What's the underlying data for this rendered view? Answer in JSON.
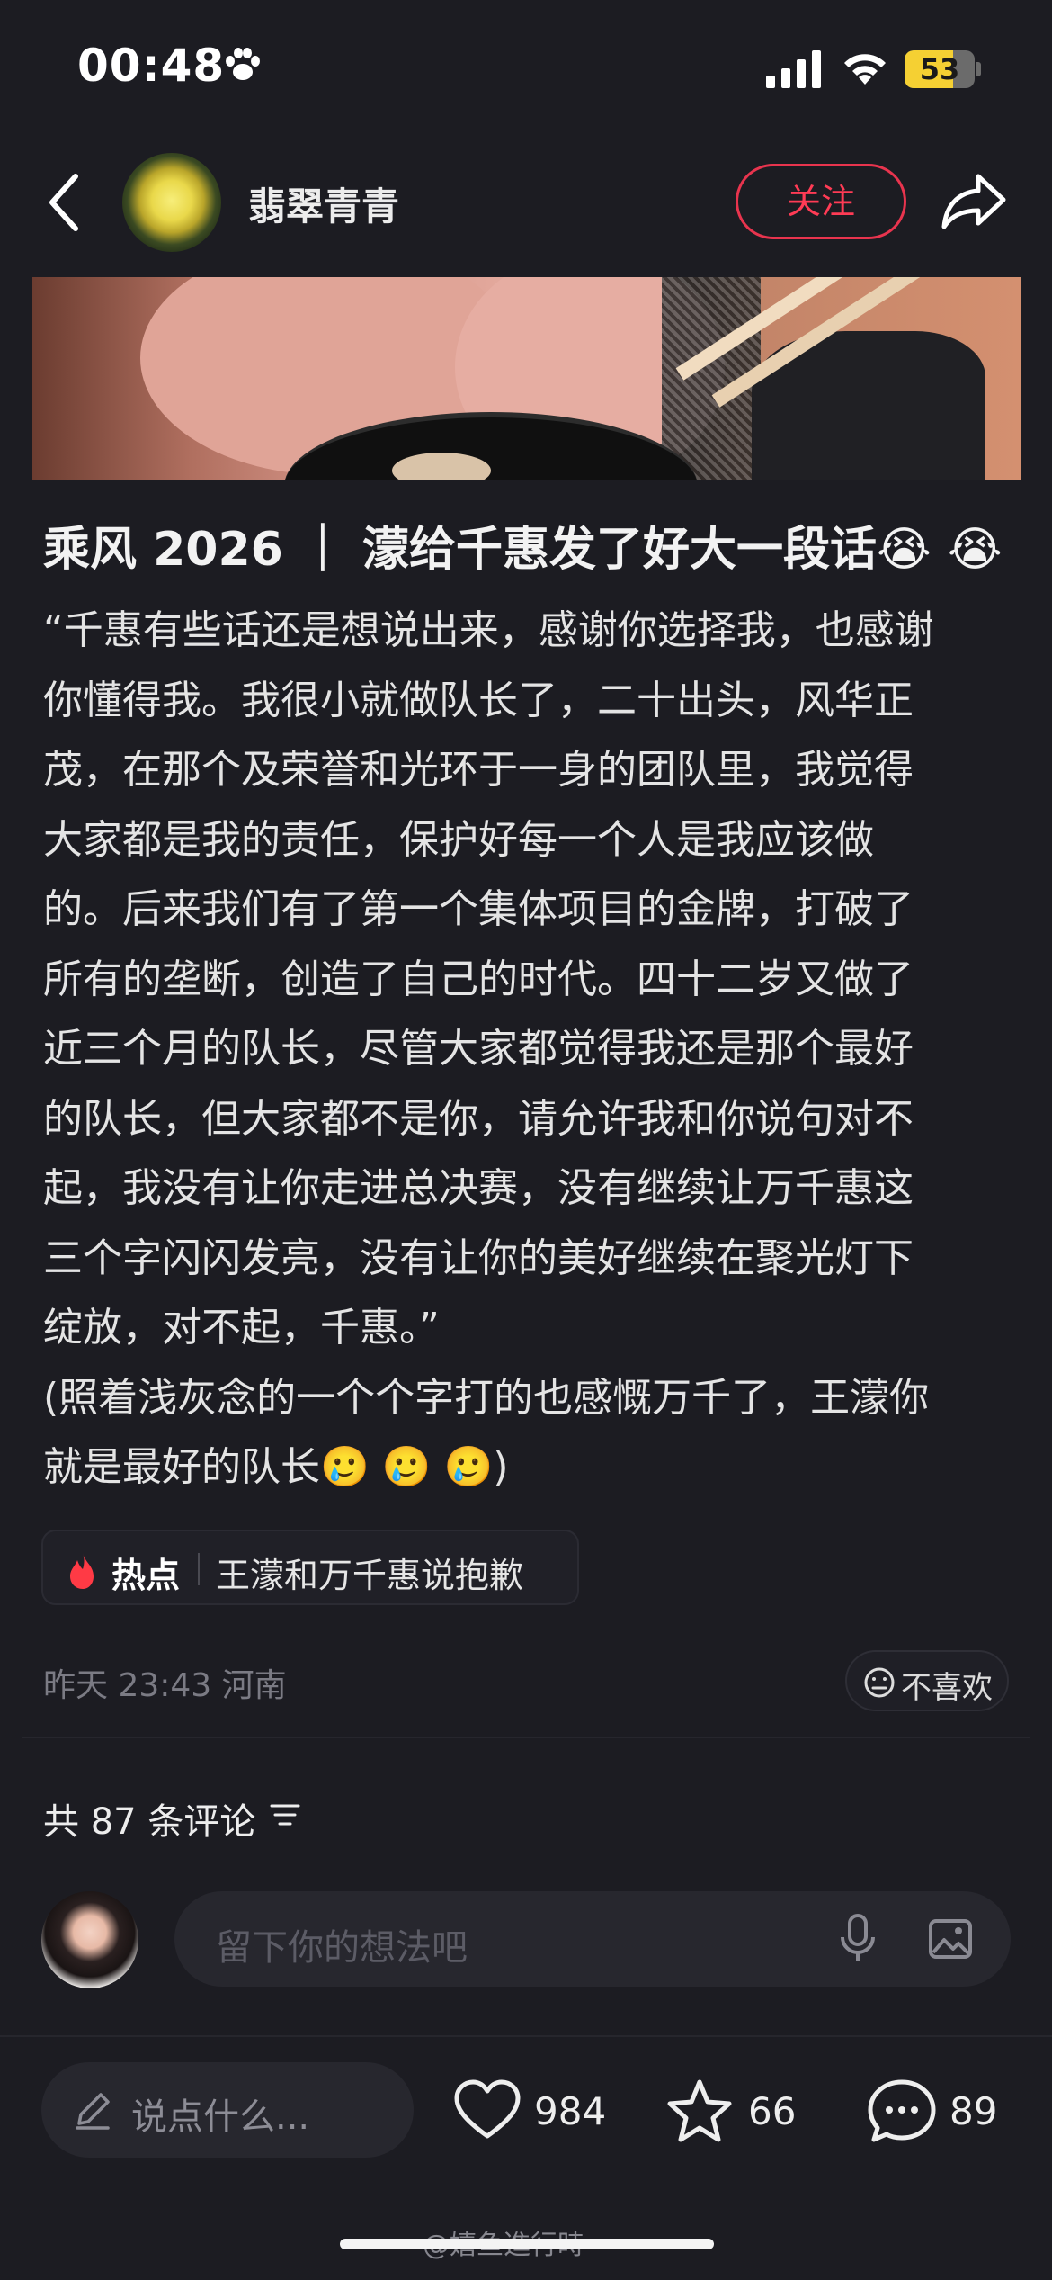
{
  "status_bar": {
    "time": "00:48",
    "battery": "53"
  },
  "header": {
    "author": "翡翠青青",
    "follow_label": "关注"
  },
  "post": {
    "title": "乘风 2026 ｜ 濛给千惠发了好大一段话😭 😭",
    "body": "“千惠有些话还是想说出来，感谢你选择我，也感谢\n你懂得我。我很小就做队长了，二十出头，风华正\n茂，在那个及荣誉和光环于一身的团队里，我觉得\n大家都是我的责任，保护好每一个人是我应该做\n的。后来我们有了第一个集体项目的金牌，打破了\n所有的垄断，创造了自己的时代。四十二岁又做了\n近三个月的队长，尽管大家都觉得我还是那个最好\n的队长，但大家都不是你，请允许我和你说句对不\n起，我没有让你走进总决赛，没有继续让万千惠这\n三个字闪闪发亮，没有让你的美好继续在聚光灯下\n绽放，对不起，千惠。”\n(照着浅灰念的一个个字打的也感慨万千了，王濛你\n就是最好的队长🥲 🥲 🥲)",
    "hot_label": "热点",
    "hot_topic": "王濛和万千惠说抱歉",
    "meta": "昨天 23:43 河南",
    "dislike_label": "不喜欢"
  },
  "comments": {
    "count_label": "共 87 条评论",
    "input_placeholder": "留下你的想法吧"
  },
  "bottom_bar": {
    "say_placeholder": "说点什么...",
    "likes": "984",
    "stars": "66",
    "comments": "89"
  },
  "watermark": "@嬉鱼進行時",
  "colors": {
    "accent": "#ff3b55",
    "background": "#1c1c22",
    "battery": "#f5d033"
  }
}
